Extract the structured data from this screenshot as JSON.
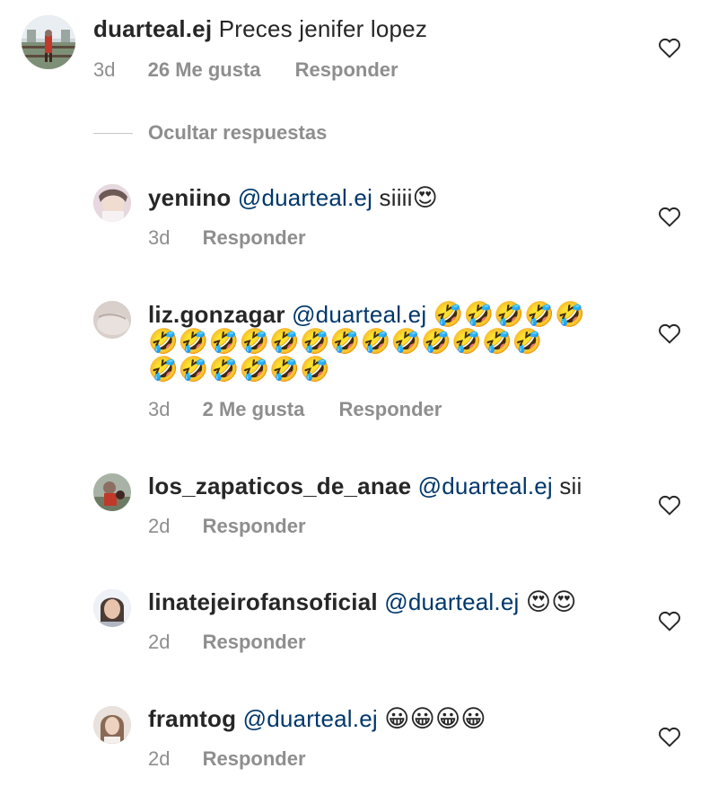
{
  "comments": [
    {
      "username": "duarteal.ej",
      "mention": "",
      "text": "Preces jenifer lopez",
      "emoji_line1": "",
      "emoji_line2": "",
      "emoji_line3": "",
      "time": "3d",
      "likes": "26 Me gusta",
      "reply": "Responder"
    },
    {
      "username": "yeniino",
      "mention": "@duarteal.ej",
      "text": "siiii",
      "emoji_line1": "😍",
      "time": "3d",
      "reply": "Responder"
    },
    {
      "username": "liz.gonzagar",
      "mention": "@duarteal.ej",
      "emoji_line1": "🤣🤣🤣🤣🤣",
      "emoji_line2": "🤣🤣🤣🤣🤣🤣🤣🤣🤣🤣🤣🤣🤣",
      "emoji_line3": "🤣🤣🤣🤣🤣🤣",
      "time": "3d",
      "likes": "2 Me gusta",
      "reply": "Responder"
    },
    {
      "username": "los_zapaticos_de_anae",
      "mention": "@duarteal.ej",
      "text": "sii",
      "time": "2d",
      "reply": "Responder"
    },
    {
      "username": "linatejeirofansoficial",
      "mention": "@duarteal.ej",
      "emoji_line1": "😍😍",
      "time": "2d",
      "reply": "Responder"
    },
    {
      "username": "framtog",
      "mention": "@duarteal.ej",
      "emoji_line1": "😀😀😀😀",
      "time": "2d",
      "reply": "Responder"
    }
  ],
  "hide_replies_label": "Ocultar respuestas",
  "icons": {
    "like": "heart-outline-icon"
  },
  "colors": {
    "username": "#262626",
    "mention": "#00376b",
    "meta": "#8e8e8e",
    "background": "#ffffff"
  }
}
